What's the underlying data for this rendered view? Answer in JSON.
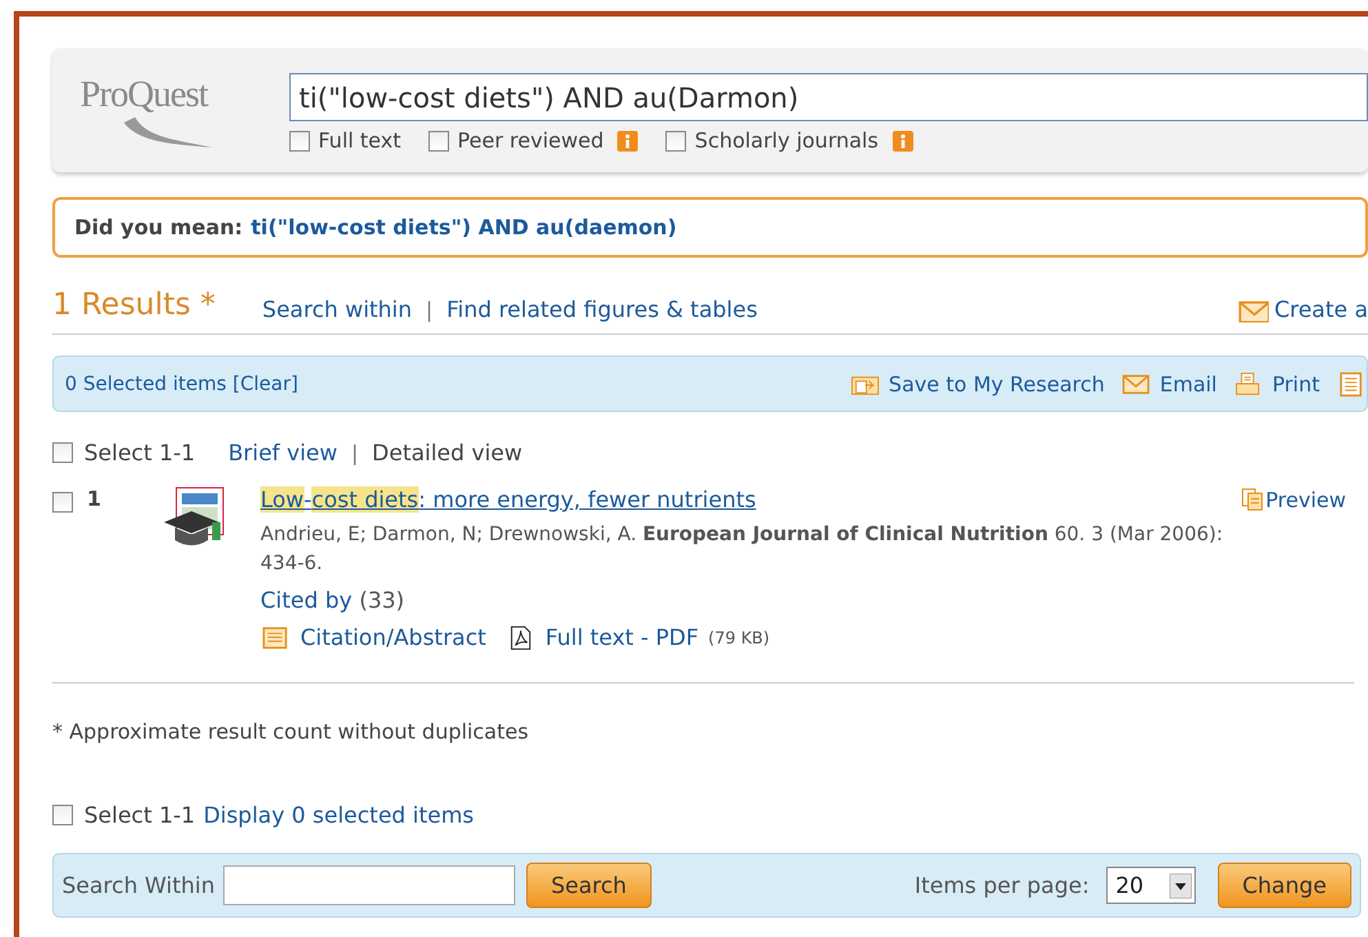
{
  "logo": "ProQuest",
  "search": {
    "value": "ti(\"low-cost diets\") AND au(Darmon)"
  },
  "filters": [
    {
      "label": "Full text",
      "checked": false,
      "info": false
    },
    {
      "label": "Peer reviewed",
      "checked": false,
      "info": true
    },
    {
      "label": "Scholarly journals",
      "checked": false,
      "info": true
    }
  ],
  "suggestion": {
    "label": "Did you mean:",
    "query": "ti(\"low-cost diets\") AND au(daemon)"
  },
  "results_count": "1 Results *",
  "result_links": {
    "items": [
      "Search within",
      "Find related figures & tables"
    ],
    "separator": "|"
  },
  "create_alert": "Create a",
  "selection_bar": {
    "status": "0 Selected items [Clear]",
    "actions": [
      {
        "kind": "save",
        "label": "Save to My Research"
      },
      {
        "kind": "email",
        "label": "Email"
      },
      {
        "kind": "print",
        "label": "Print"
      },
      {
        "kind": "list"
      }
    ]
  },
  "list_controls": {
    "select": {
      "label": "Select 1-1",
      "checked": false
    },
    "separator": "|",
    "views": [
      {
        "label": "Brief view",
        "selected": false
      },
      {
        "label": "Detailed view",
        "selected": true
      }
    ]
  },
  "results": [
    {
      "number": "1",
      "checked": false,
      "title_parts": [
        {
          "text": "Low",
          "highlight": true
        },
        {
          "text": "-",
          "highlight": false
        },
        {
          "text": "cost diets",
          "highlight": true
        },
        {
          "text": ": more energy, fewer nutrients",
          "highlight": false
        }
      ],
      "preview": "Preview",
      "citation": "Andrieu, E; Darmon, N; Drewnowski, A. **European Journal of Clinical Nutrition** 60. 3  (Mar 2006): 434-6.",
      "cited_by": "Cited by",
      "cited_count": "(33)",
      "links": [
        {
          "kind": "abstract",
          "label": "Citation/Abstract"
        },
        {
          "kind": "pdf",
          "label": "Full text - PDF",
          "size": "(79 KB)"
        }
      ]
    }
  ],
  "footnote": "* Approximate result count without duplicates",
  "bottom_select": {
    "label": "Select 1-1",
    "checked": false,
    "link": "Display 0 selected items"
  },
  "search_within": {
    "label": "Search Within",
    "button": "Search"
  },
  "paging": {
    "label": "Items per page:",
    "value": "20",
    "button": "Change"
  }
}
